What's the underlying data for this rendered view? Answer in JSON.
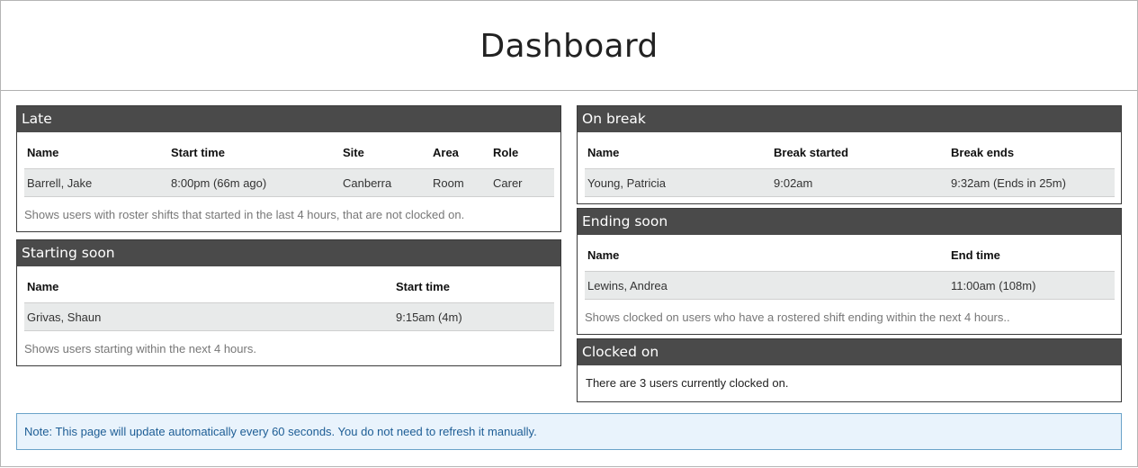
{
  "header": {
    "title": "Dashboard"
  },
  "late": {
    "title": "Late",
    "columns": [
      "Name",
      "Start time",
      "Site",
      "Area",
      "Role"
    ],
    "rows": [
      [
        "Barrell, Jake",
        "8:00pm (66m ago)",
        "Canberra",
        "Room",
        "Carer"
      ]
    ],
    "note": "Shows users with roster shifts that started in the last 4 hours, that are not clocked on."
  },
  "starting_soon": {
    "title": "Starting soon",
    "columns": [
      "Name",
      "Start time"
    ],
    "rows": [
      [
        "Grivas, Shaun",
        "9:15am (4m)"
      ]
    ],
    "note": "Shows users starting within the next 4 hours."
  },
  "on_break": {
    "title": "On break",
    "columns": [
      "Name",
      "Break started",
      "Break ends"
    ],
    "rows": [
      [
        "Young, Patricia",
        "9:02am",
        "9:32am (Ends in 25m)"
      ]
    ]
  },
  "ending_soon": {
    "title": "Ending soon",
    "columns": [
      "Name",
      "End time"
    ],
    "rows": [
      [
        "Lewins, Andrea",
        "11:00am (108m)"
      ]
    ],
    "note": "Shows clocked on users who have a rostered shift ending within the next 4 hours.."
  },
  "clocked_on": {
    "title": "Clocked on",
    "text": "There are 3 users currently clocked on."
  },
  "notice": {
    "text": "Note: This page will update automatically every 60 seconds. You do not need to refresh it manually."
  },
  "colors": {
    "panel_header_bg": "#4a4a4a",
    "row_bg": "#e8eaea",
    "notice_bg": "#e9f3fc",
    "notice_border": "#6aa3c9",
    "notice_text": "#1d5d95"
  }
}
